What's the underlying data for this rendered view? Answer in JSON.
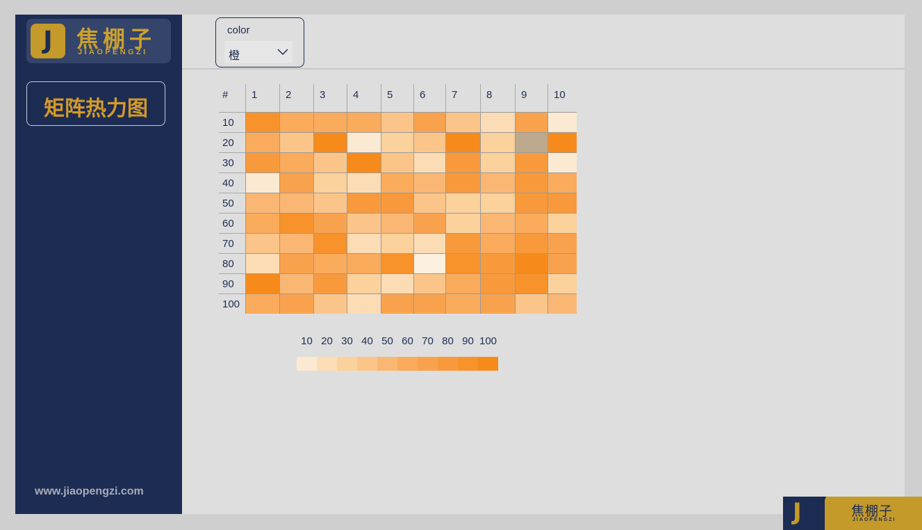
{
  "logo": {
    "letter": "J",
    "name_cn": "焦棚子",
    "name_en": "JIAOPENGZI"
  },
  "sidebar": {
    "title": "矩阵热力图",
    "website": "www.jiaopengzi.com"
  },
  "filter": {
    "label": "color",
    "selected": "橙"
  },
  "brand": {
    "letter": "J",
    "name_cn": "焦棚子",
    "name_en": "JIAOPENGZI"
  },
  "colors": {
    "sidebar_bg": "#1d2c52",
    "accent_gold": "#c49a2a",
    "palette": [
      "#fbe9d2",
      "#fbdcb4",
      "#fbd19c",
      "#fbc589",
      "#fab774",
      "#faab5c",
      "#f9a24d",
      "#f89a3c",
      "#f8922a",
      "#f68b1c"
    ],
    "missing": "#bca98e"
  },
  "chart_data": {
    "type": "heatmap",
    "corner_label": "#",
    "x_labels": [
      "1",
      "2",
      "3",
      "4",
      "5",
      "6",
      "7",
      "8",
      "9",
      "10"
    ],
    "y_labels": [
      "10",
      "20",
      "30",
      "40",
      "50",
      "60",
      "70",
      "80",
      "90",
      "100"
    ],
    "values": [
      [
        90,
        60,
        60,
        60,
        40,
        70,
        40,
        20,
        70,
        10
      ],
      [
        60,
        40,
        100,
        10,
        30,
        40,
        100,
        30,
        null,
        100
      ],
      [
        80,
        60,
        40,
        100,
        40,
        20,
        80,
        30,
        80,
        10
      ],
      [
        10,
        70,
        30,
        20,
        60,
        50,
        80,
        50,
        80,
        60
      ],
      [
        50,
        50,
        40,
        80,
        80,
        40,
        30,
        30,
        80,
        80
      ],
      [
        60,
        90,
        70,
        40,
        50,
        70,
        30,
        50,
        60,
        30
      ],
      [
        40,
        50,
        90,
        20,
        30,
        20,
        80,
        60,
        80,
        70
      ],
      [
        20,
        70,
        60,
        60,
        90,
        5,
        90,
        80,
        100,
        70
      ],
      [
        100,
        50,
        80,
        30,
        20,
        40,
        60,
        80,
        90,
        30
      ],
      [
        60,
        70,
        40,
        20,
        70,
        70,
        60,
        70,
        40,
        50
      ]
    ],
    "legend": {
      "labels": [
        "10",
        "20",
        "30",
        "40",
        "50",
        "60",
        "70",
        "80",
        "90",
        "100"
      ]
    }
  }
}
